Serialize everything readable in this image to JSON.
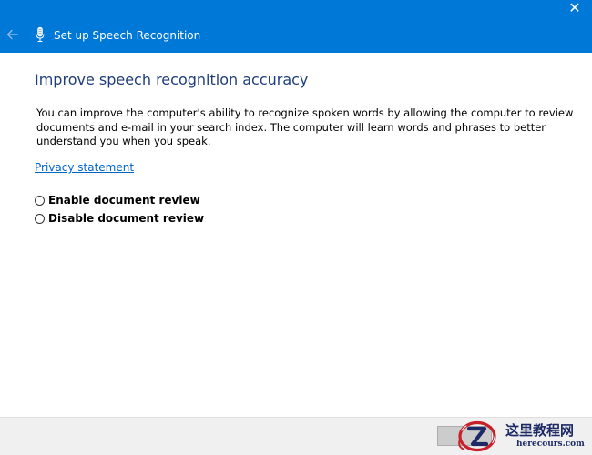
{
  "window": {
    "title": "Set up Speech Recognition",
    "close_glyph": "✕"
  },
  "icons": {
    "back": "back-arrow-icon",
    "microphone": "microphone-icon",
    "close": "close-icon"
  },
  "content": {
    "heading": "Improve speech recognition accuracy",
    "description": "You can improve the computer's ability to recognize spoken words by allowing the computer to review documents and e-mail in your search index. The computer will learn words and phrases to better understand you when you speak.",
    "privacy_link": "Privacy statement",
    "options": [
      {
        "label": "Enable document review",
        "selected": false
      },
      {
        "label": "Disable document review",
        "selected": false
      }
    ]
  },
  "footer": {
    "next_label": ""
  },
  "watermark": {
    "cn_text": "这里教程网",
    "en_text": "herecours.com"
  },
  "colors": {
    "titlebar": "#0078d7",
    "heading": "#1f3d7a",
    "link": "#0066cc",
    "watermark_red": "#c8202a",
    "watermark_navy": "#1e2a66"
  }
}
